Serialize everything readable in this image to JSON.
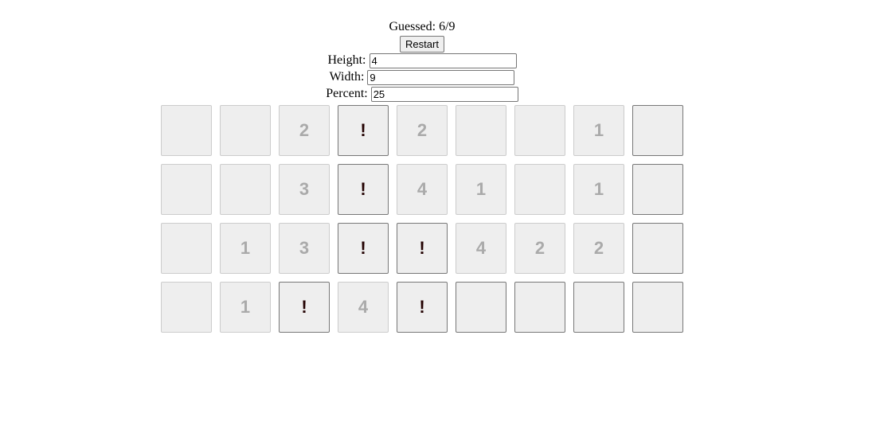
{
  "status": {
    "label": "Guessed:",
    "value": "6/9"
  },
  "restart_label": "Restart",
  "fields": {
    "height": {
      "label": "Height:",
      "value": "4"
    },
    "width": {
      "label": "Width:",
      "value": "9"
    },
    "percent": {
      "label": "Percent:",
      "value": "25"
    }
  },
  "board": [
    [
      [
        "r",
        ""
      ],
      [
        "r",
        ""
      ],
      [
        "r",
        "2"
      ],
      [
        "f",
        "!"
      ],
      [
        "r",
        "2"
      ],
      [
        "r",
        ""
      ],
      [
        "r",
        ""
      ],
      [
        "r",
        "1"
      ],
      [
        "h",
        ""
      ]
    ],
    [
      [
        "r",
        ""
      ],
      [
        "r",
        ""
      ],
      [
        "r",
        "3"
      ],
      [
        "f",
        "!"
      ],
      [
        "r",
        "4"
      ],
      [
        "r",
        "1"
      ],
      [
        "r",
        ""
      ],
      [
        "r",
        "1"
      ],
      [
        "h",
        ""
      ]
    ],
    [
      [
        "r",
        ""
      ],
      [
        "r",
        "1"
      ],
      [
        "r",
        "3"
      ],
      [
        "f",
        "!"
      ],
      [
        "f",
        "!"
      ],
      [
        "r",
        "4"
      ],
      [
        "r",
        "2"
      ],
      [
        "r",
        "2"
      ],
      [
        "h",
        ""
      ]
    ],
    [
      [
        "r",
        ""
      ],
      [
        "r",
        "1"
      ],
      [
        "f",
        "!"
      ],
      [
        "r",
        "4"
      ],
      [
        "f",
        "!"
      ],
      [
        "h",
        ""
      ],
      [
        "h",
        ""
      ],
      [
        "h",
        ""
      ],
      [
        "h",
        ""
      ]
    ]
  ]
}
